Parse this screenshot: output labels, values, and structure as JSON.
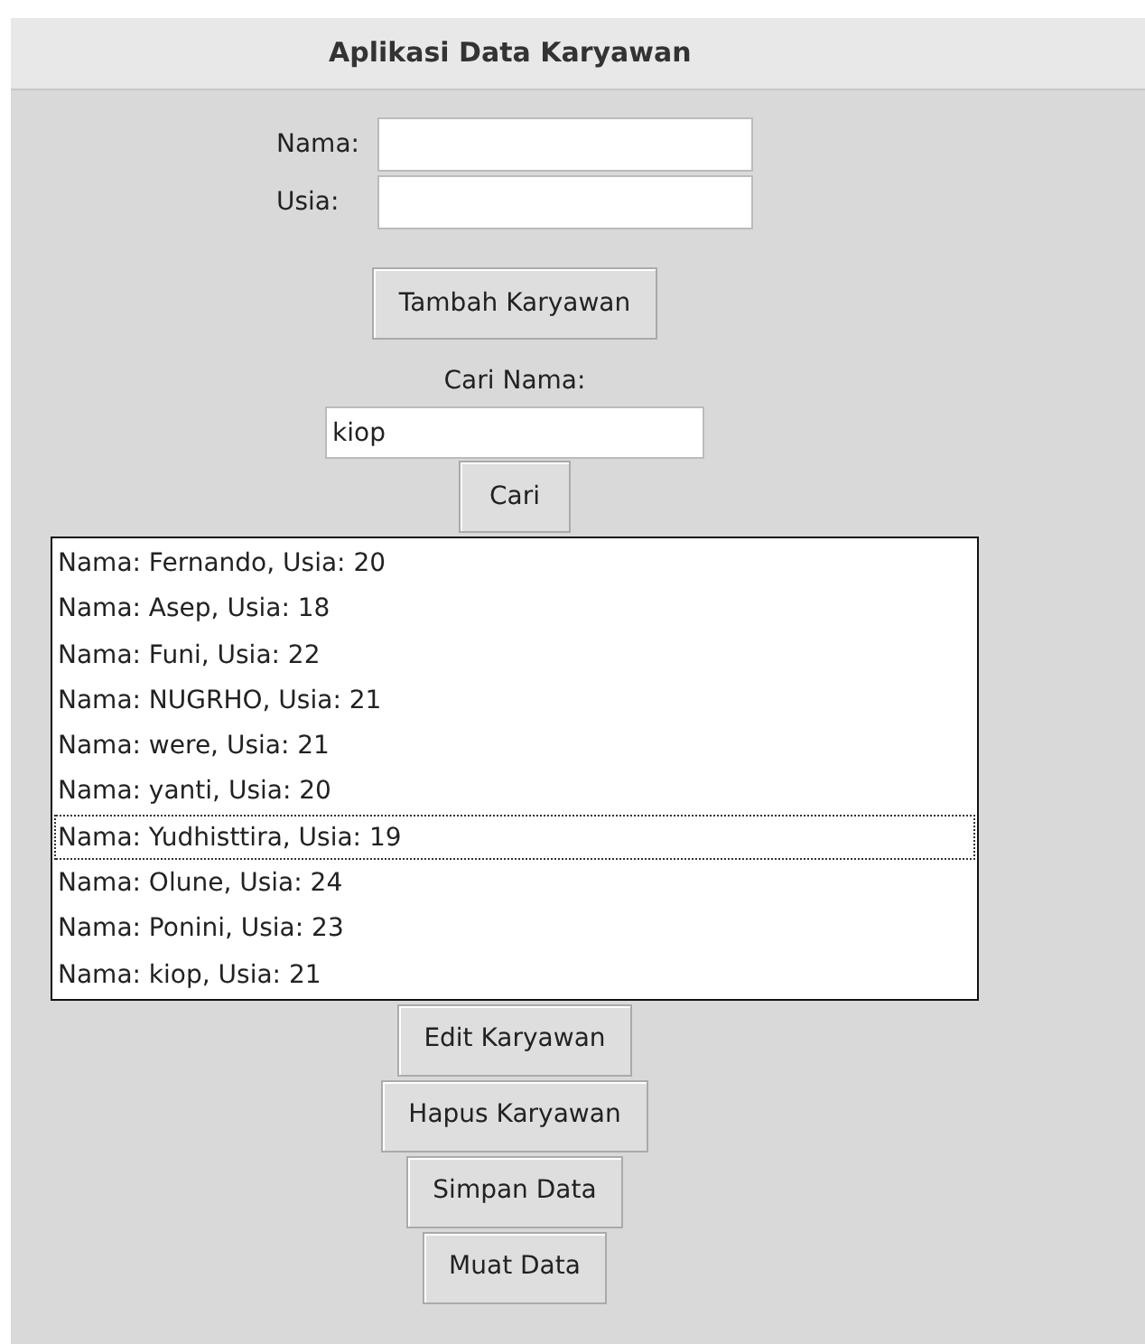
{
  "window": {
    "title": "Aplikasi Data Karyawan"
  },
  "form": {
    "fields": [
      {
        "label": "Nama:"
      },
      {
        "label": "Usia:"
      }
    ],
    "add_button": "Tambah Karyawan"
  },
  "search": {
    "label": "Cari Nama:",
    "value": "kiop",
    "button": "Cari"
  },
  "employees": [
    {
      "text": "Nama: Fernando, Usia: 20",
      "focused": false
    },
    {
      "text": "Nama: Asep, Usia: 18",
      "focused": false
    },
    {
      "text": "Nama: Funi, Usia: 22",
      "focused": false
    },
    {
      "text": "Nama: NUGRHO, Usia: 21",
      "focused": false
    },
    {
      "text": "Nama: were, Usia: 21",
      "focused": false
    },
    {
      "text": "Nama: yanti, Usia: 20",
      "focused": false
    },
    {
      "text": "Nama: Yudhisttira, Usia: 19",
      "focused": true
    },
    {
      "text": "Nama: Olune, Usia: 24",
      "focused": false
    },
    {
      "text": "Nama: Ponini, Usia: 23",
      "focused": false
    },
    {
      "text": "Nama: kiop, Usia: 21",
      "focused": false
    }
  ],
  "actions": [
    "Edit Karyawan",
    "Hapus Karyawan",
    "Simpan Data",
    "Muat Data"
  ]
}
